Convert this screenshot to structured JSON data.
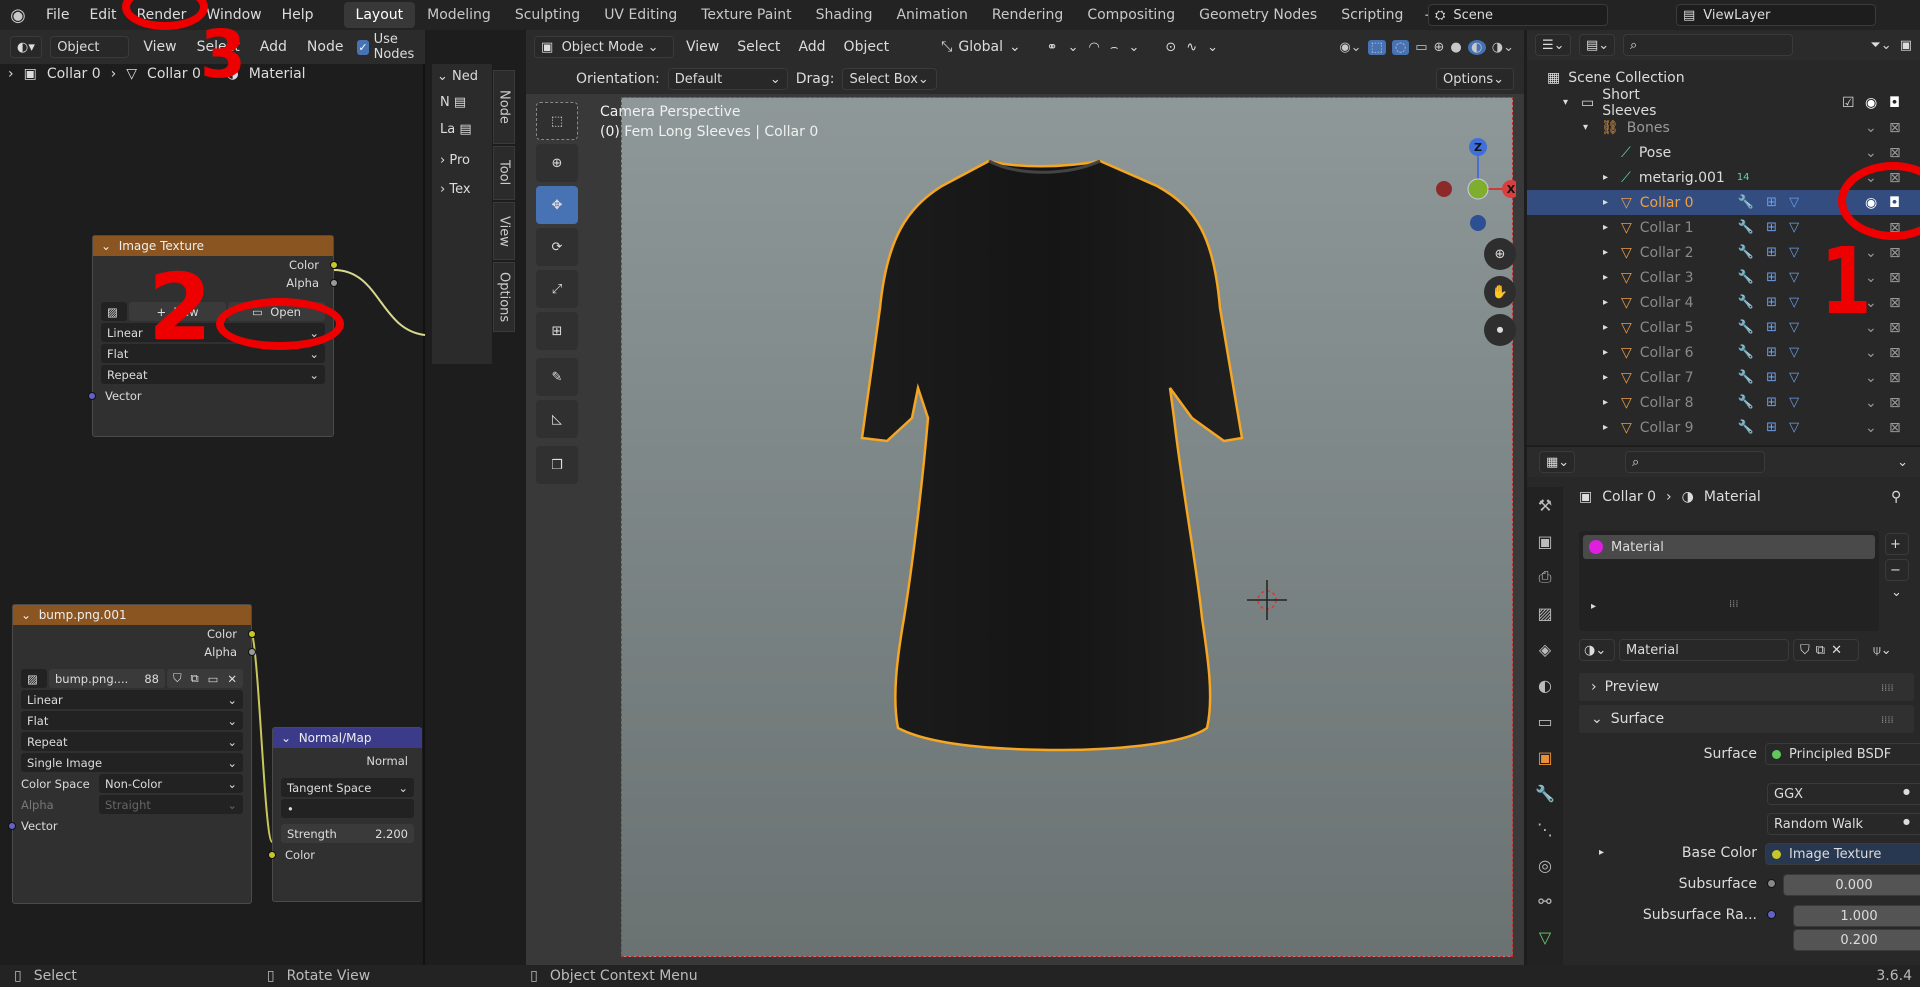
{
  "menubar": {
    "items": [
      "File",
      "Edit",
      "Render",
      "Window",
      "Help"
    ],
    "workspaces": [
      "Layout",
      "Modeling",
      "Sculpting",
      "UV Editing",
      "Texture Paint",
      "Shading",
      "Animation",
      "Rendering",
      "Compositing",
      "Geometry Nodes",
      "Scripting"
    ],
    "active_workspace": "Layout",
    "scene": "Scene",
    "view_layer": "ViewLayer"
  },
  "node_editor": {
    "header": {
      "mode": "Object",
      "menus": [
        "View",
        "Select",
        "Add",
        "Node"
      ],
      "use_nodes": "Use Nodes"
    },
    "breadcrumb": [
      "Collar 0",
      "Collar 0",
      "Material"
    ],
    "n_panel_tabs": [
      "Node",
      "Tool",
      "View",
      "Options"
    ],
    "n_panel_fragments": [
      "Ned",
      "N",
      "La",
      "Pro",
      "Tex"
    ],
    "image_texture": {
      "title": "Image Texture",
      "outputs": [
        "Color",
        "Alpha"
      ],
      "new_label": "New",
      "open_label": "Open",
      "interpolation": "Linear",
      "projection": "Flat",
      "extension": "Repeat",
      "input": "Vector"
    },
    "bump_node": {
      "title": "bump.png.001",
      "outputs": [
        "Color",
        "Alpha"
      ],
      "image_name": "bump.png....",
      "users": "88",
      "interpolation": "Linear",
      "projection": "Flat",
      "extension": "Repeat",
      "source": "Single Image",
      "color_space_label": "Color Space",
      "color_space": "Non-Color",
      "alpha_label": "Alpha",
      "alpha": "Straight",
      "input": "Vector"
    },
    "normal_map": {
      "title": "Normal/Map",
      "output": "Normal",
      "space": "Tangent Space",
      "uv": "•",
      "strength_label": "Strength",
      "strength": "2.200",
      "input": "Color"
    }
  },
  "viewport": {
    "mode": "Object Mode",
    "menus": [
      "View",
      "Select",
      "Add",
      "Object"
    ],
    "transform": "Global",
    "orientation_label": "Orientation:",
    "orientation": "Default",
    "drag_label": "Drag:",
    "drag": "Select Box",
    "options": "Options",
    "camera_text": "Camera Perspective",
    "object_text": "(0) Fem Long Sleeves | Collar 0",
    "gizmo": {
      "x": "X",
      "z": "Z"
    }
  },
  "outliner": {
    "root": "Scene Collection",
    "rows": [
      {
        "label": "Short Sleeves",
        "level": 1
      },
      {
        "label": "Bones",
        "level": 2
      },
      {
        "label": "Pose",
        "level": 3
      },
      {
        "label": "metarig.001",
        "level": 3,
        "badge": "14"
      },
      {
        "label": "Collar 0",
        "level": 3,
        "selected": true
      },
      {
        "label": "Collar 1",
        "level": 3
      },
      {
        "label": "Collar 2",
        "level": 3
      },
      {
        "label": "Collar 3",
        "level": 3
      },
      {
        "label": "Collar 4",
        "level": 3
      },
      {
        "label": "Collar 5",
        "level": 3
      },
      {
        "label": "Collar 6",
        "level": 3
      },
      {
        "label": "Collar 7",
        "level": 3
      },
      {
        "label": "Collar 8",
        "level": 3
      },
      {
        "label": "Collar 9",
        "level": 3
      }
    ]
  },
  "properties": {
    "breadcrumb": [
      "Collar 0",
      "Material"
    ],
    "slot": "Material",
    "material_name": "Material",
    "panels": [
      "Preview",
      "Surface"
    ],
    "surface_label": "Surface",
    "surface": "Principled BSDF",
    "distribution": "GGX",
    "subsurface_method": "Random Walk",
    "base_color_label": "Base Color",
    "base_color": "Image Texture",
    "subsurface_label": "Subsurface",
    "subsurface": "0.000",
    "subsurface_radius_label": "Subsurface Ra...",
    "subsurface_radius": [
      "1.000",
      "0.200"
    ]
  },
  "status": {
    "items": [
      "Select",
      "Rotate View",
      "Object Context Menu"
    ],
    "version": "3.6.4"
  },
  "annotations": {
    "one": "1",
    "two": "2",
    "three": "3",
    "color": "#e00000"
  },
  "colors": {
    "accent": "#4772b3",
    "image_node_header": "#8a5520",
    "vector_node_header": "#3b3b8a",
    "selected_row": "#334d80",
    "outline": "#f5a623"
  }
}
